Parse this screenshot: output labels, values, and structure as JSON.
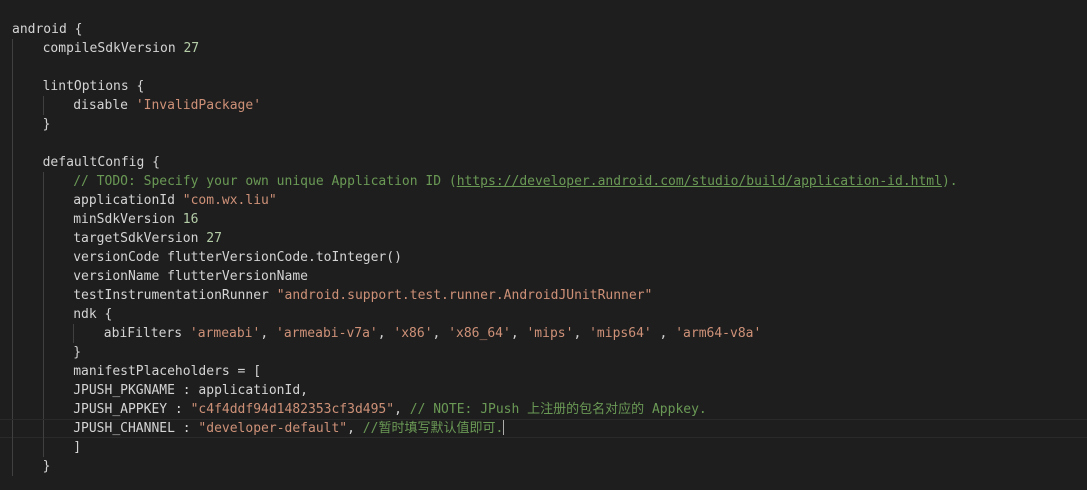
{
  "editor": {
    "lines": [
      {
        "indent": 0,
        "tokens": [
          {
            "t": "plain",
            "v": "android {"
          }
        ]
      },
      {
        "indent": 1,
        "tokens": [
          {
            "t": "plain",
            "v": "compileSdkVersion "
          },
          {
            "t": "num",
            "v": "27"
          }
        ]
      },
      {
        "indent": 1,
        "tokens": []
      },
      {
        "indent": 1,
        "tokens": [
          {
            "t": "plain",
            "v": "lintOptions {"
          }
        ]
      },
      {
        "indent": 2,
        "tokens": [
          {
            "t": "plain",
            "v": "disable "
          },
          {
            "t": "str",
            "v": "'InvalidPackage'"
          }
        ]
      },
      {
        "indent": 1,
        "tokens": [
          {
            "t": "plain",
            "v": "}"
          }
        ]
      },
      {
        "indent": 1,
        "tokens": []
      },
      {
        "indent": 1,
        "tokens": [
          {
            "t": "plain",
            "v": "defaultConfig {"
          }
        ]
      },
      {
        "indent": 2,
        "tokens": [
          {
            "t": "cmt",
            "v": "// TODO: Specify your own unique Application ID ("
          },
          {
            "t": "url",
            "v": "https://developer.android.com/studio/build/application-id.html"
          },
          {
            "t": "cmt",
            "v": ")."
          }
        ]
      },
      {
        "indent": 2,
        "tokens": [
          {
            "t": "plain",
            "v": "applicationId "
          },
          {
            "t": "str",
            "v": "\"com.wx.liu\""
          }
        ]
      },
      {
        "indent": 2,
        "tokens": [
          {
            "t": "plain",
            "v": "minSdkVersion "
          },
          {
            "t": "num",
            "v": "16"
          }
        ]
      },
      {
        "indent": 2,
        "tokens": [
          {
            "t": "plain",
            "v": "targetSdkVersion "
          },
          {
            "t": "num",
            "v": "27"
          }
        ]
      },
      {
        "indent": 2,
        "tokens": [
          {
            "t": "plain",
            "v": "versionCode flutterVersionCode.toInteger()"
          }
        ]
      },
      {
        "indent": 2,
        "tokens": [
          {
            "t": "plain",
            "v": "versionName flutterVersionName"
          }
        ]
      },
      {
        "indent": 2,
        "tokens": [
          {
            "t": "plain",
            "v": "testInstrumentationRunner "
          },
          {
            "t": "str",
            "v": "\"android.support.test.runner.AndroidJUnitRunner\""
          }
        ]
      },
      {
        "indent": 2,
        "tokens": [
          {
            "t": "plain",
            "v": "ndk {"
          }
        ]
      },
      {
        "indent": 3,
        "tokens": [
          {
            "t": "plain",
            "v": "abiFilters "
          },
          {
            "t": "str",
            "v": "'armeabi'"
          },
          {
            "t": "plain",
            "v": ", "
          },
          {
            "t": "str",
            "v": "'armeabi-v7a'"
          },
          {
            "t": "plain",
            "v": ", "
          },
          {
            "t": "str",
            "v": "'x86'"
          },
          {
            "t": "plain",
            "v": ", "
          },
          {
            "t": "str",
            "v": "'x86_64'"
          },
          {
            "t": "plain",
            "v": ", "
          },
          {
            "t": "str",
            "v": "'mips'"
          },
          {
            "t": "plain",
            "v": ", "
          },
          {
            "t": "str",
            "v": "'mips64'"
          },
          {
            "t": "plain",
            "v": " , "
          },
          {
            "t": "str",
            "v": "'arm64-v8a'"
          }
        ]
      },
      {
        "indent": 2,
        "tokens": [
          {
            "t": "plain",
            "v": "}"
          }
        ]
      },
      {
        "indent": 2,
        "tokens": [
          {
            "t": "plain",
            "v": "manifestPlaceholders = ["
          }
        ]
      },
      {
        "indent": 2,
        "tokens": [
          {
            "t": "plain",
            "v": "JPUSH_PKGNAME : applicationId,"
          }
        ]
      },
      {
        "indent": 2,
        "tokens": [
          {
            "t": "plain",
            "v": "JPUSH_APPKEY : "
          },
          {
            "t": "str",
            "v": "\"c4f4ddf94d1482353cf3d495\""
          },
          {
            "t": "plain",
            "v": ", "
          },
          {
            "t": "cmt",
            "v": "// NOTE: JPush 上注册的包名对应的 Appkey."
          }
        ]
      },
      {
        "indent": 2,
        "current": true,
        "tokens": [
          {
            "t": "plain",
            "v": "JPUSH_CHANNEL : "
          },
          {
            "t": "str",
            "v": "\"developer-default\""
          },
          {
            "t": "plain",
            "v": ", "
          },
          {
            "t": "cmt",
            "v": "//暂时填写默认值即可."
          },
          {
            "t": "cursor",
            "v": ""
          }
        ]
      },
      {
        "indent": 2,
        "tokens": [
          {
            "t": "plain",
            "v": "]"
          }
        ]
      },
      {
        "indent": 1,
        "tokens": [
          {
            "t": "plain",
            "v": "}"
          }
        ]
      }
    ]
  },
  "colors": {
    "background": "#1e1e1e",
    "text": "#d4d4d4",
    "string": "#ce9178",
    "number": "#b5cea8",
    "comment": "#6a9955"
  }
}
